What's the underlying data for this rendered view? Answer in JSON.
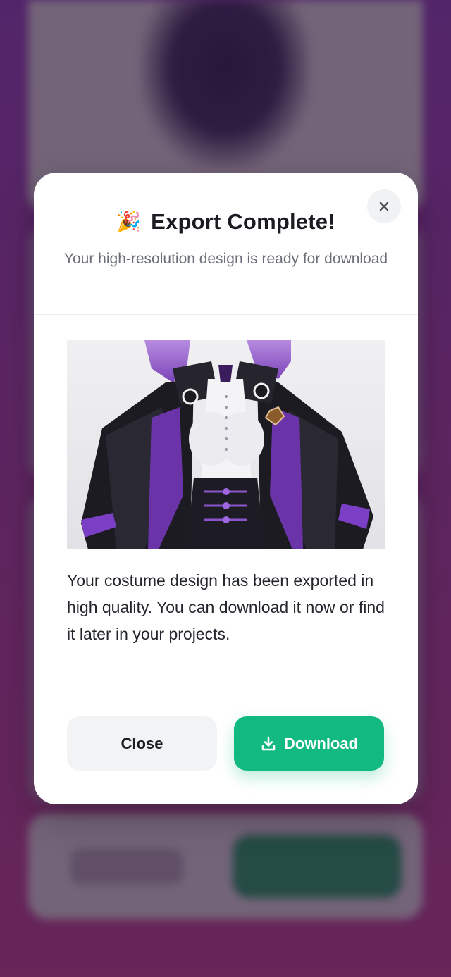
{
  "modal": {
    "emoji": "🎉",
    "title": "Export Complete!",
    "subtitle": "Your high-resolution design is ready for download",
    "description": "Your costume design has been exported in high quality. You can download it now or find it later in your projects.",
    "close_label": "Close",
    "download_label": "Download",
    "close_icon": "close-icon",
    "download_icon": "download-icon",
    "preview_subject": "costume-preview-image"
  },
  "colors": {
    "accent": "#12b981",
    "title": "#1b1c22",
    "muted": "#6b6e78",
    "close_button_bg": "#f2f3f5"
  }
}
